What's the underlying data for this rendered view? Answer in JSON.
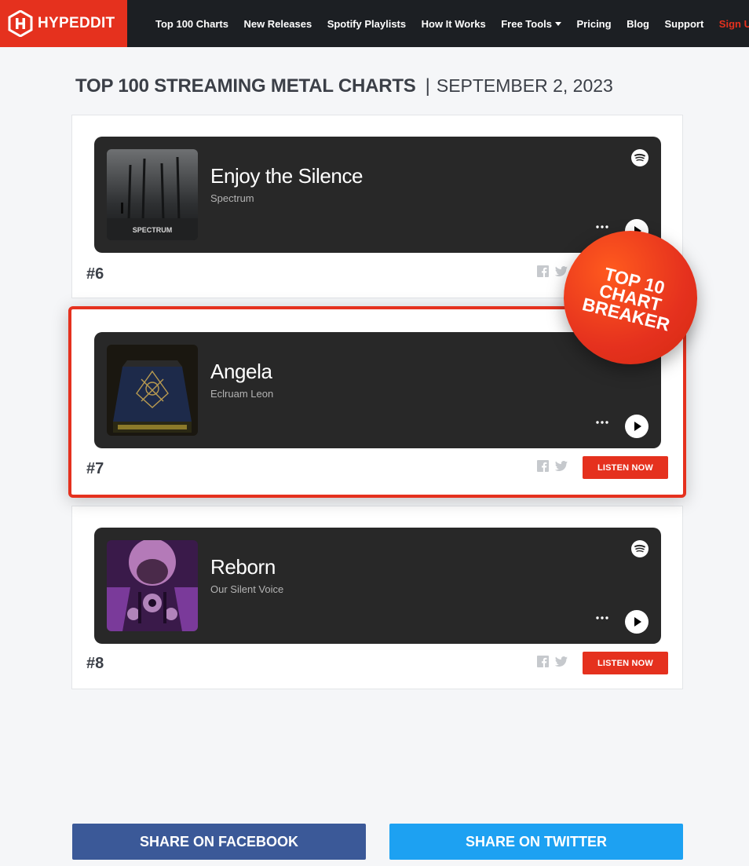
{
  "header": {
    "brand": "HYPEDDIT",
    "nav": [
      {
        "label": "Top 100 Charts"
      },
      {
        "label": "New Releases"
      },
      {
        "label": "Spotify Playlists"
      },
      {
        "label": "How It Works"
      },
      {
        "label": "Free Tools"
      },
      {
        "label": "Pricing"
      },
      {
        "label": "Blog"
      },
      {
        "label": "Support"
      }
    ],
    "signup": "Sign Up"
  },
  "page": {
    "title": "TOP 100 STREAMING METAL CHARTS",
    "separator": "|",
    "date": "SEPTEMBER 2, 2023"
  },
  "tracks": [
    {
      "rank": "#6",
      "title": "Enjoy the Silence",
      "artist": "Spectrum",
      "featured": false
    },
    {
      "rank": "#7",
      "title": "Angela",
      "artist": "Eclruam Leon",
      "featured": true,
      "listen_label": "LISTEN NOW"
    },
    {
      "rank": "#8",
      "title": "Reborn",
      "artist": "Our Silent Voice",
      "featured": false,
      "listen_label": "LISTEN NOW"
    }
  ],
  "badge": {
    "line1": "TOP 10",
    "line2": "CHART",
    "line3": "BREAKER"
  },
  "share": {
    "facebook": "SHARE ON FACEBOOK",
    "twitter": "SHARE ON TWITTER"
  },
  "colors": {
    "brand_red": "#e5311e",
    "navbar": "#1c1f23",
    "facebook": "#3b5998",
    "twitter": "#1da1f2",
    "player_bg": "#282828"
  },
  "icons": [
    "hypeddit-logo-icon",
    "spotify-icon",
    "more-icon",
    "play-icon",
    "facebook-icon",
    "twitter-icon",
    "caret-down-icon"
  ]
}
